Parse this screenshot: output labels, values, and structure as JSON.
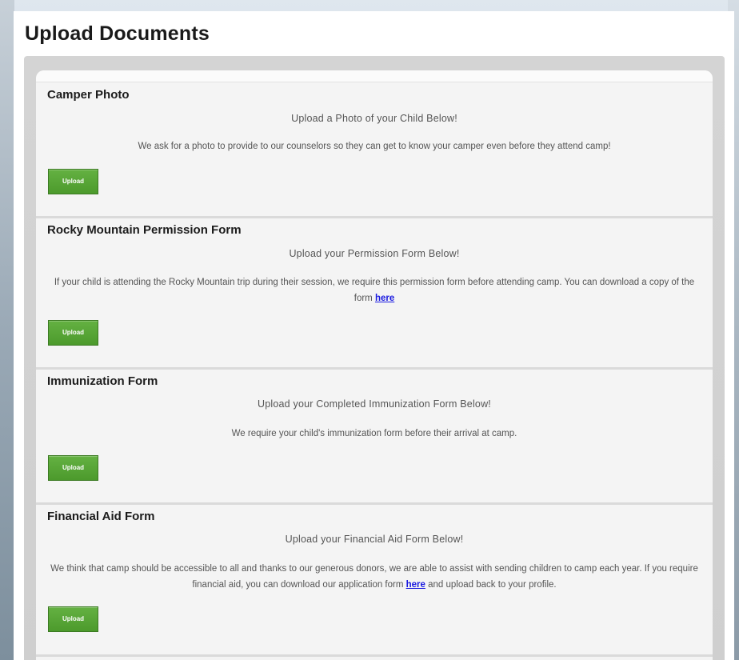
{
  "page": {
    "title": "Upload Documents"
  },
  "sections": [
    {
      "title": "Camper Photo",
      "subtitle": "Upload a Photo of your Child Below!",
      "description": "We ask for a photo to provide to our counselors so they can get to know your camper even before they attend camp!",
      "button_label": "Upload"
    },
    {
      "title": "Rocky Mountain Permission Form",
      "subtitle": "Upload your Permission Form Below!",
      "description_before_link": "If your child is attending the Rocky Mountain trip during their session, we require this permission form before attending camp. You can download a copy of the form ",
      "link_text": "here",
      "description_after_link": "",
      "button_label": "Upload"
    },
    {
      "title": "Immunization Form",
      "subtitle": "Upload your Completed Immunization Form Below!",
      "description": "We require your child's immunization form before their arrival at camp.",
      "button_label": "Upload"
    },
    {
      "title": "Financial Aid Form",
      "subtitle": "Upload your Financial Aid Form Below!",
      "description_before_link": "We think that camp should be accessible to all and thanks to our generous donors, we are able to assist with sending children to camp each year. If you require financial aid, you can download our application form ",
      "link_text": "here",
      "description_after_link": " and upload back to your profile.",
      "button_label": "Upload"
    }
  ],
  "colors": {
    "button_green": "#4c9a2c",
    "link_blue": "#1a1ae0"
  }
}
